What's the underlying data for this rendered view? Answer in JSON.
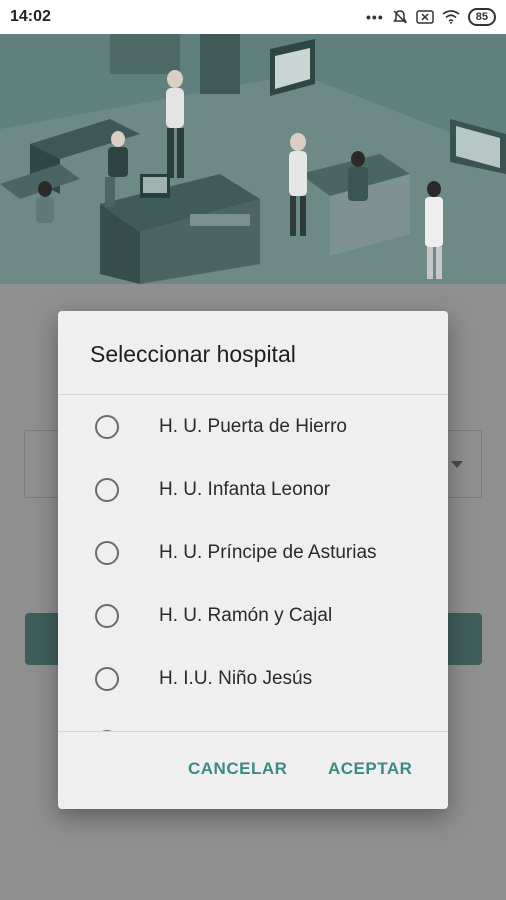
{
  "status_bar": {
    "time": "14:02",
    "battery": "85",
    "icons": [
      "more-dots-icon",
      "bell-muted-icon",
      "sim-x-icon",
      "wifi-icon",
      "battery-icon"
    ]
  },
  "hero": {
    "illustration": "hospital-waiting-room-illustration"
  },
  "dialog": {
    "title": "Seleccionar hospital",
    "options": [
      {
        "label": "H. U. Puerta de Hierro"
      },
      {
        "label": "H. U. Infanta Leonor"
      },
      {
        "label": "H. U. Príncipe de Asturias"
      },
      {
        "label": "H. U. Ramón y Cajal"
      },
      {
        "label": "H. I.U. Niño Jesús"
      }
    ],
    "cancel_label": "CANCELAR",
    "accept_label": "ACEPTAR"
  },
  "colors": {
    "accent": "#3c8a83",
    "hero": "#4e6f6c",
    "scrim": "#8f8f8f"
  }
}
